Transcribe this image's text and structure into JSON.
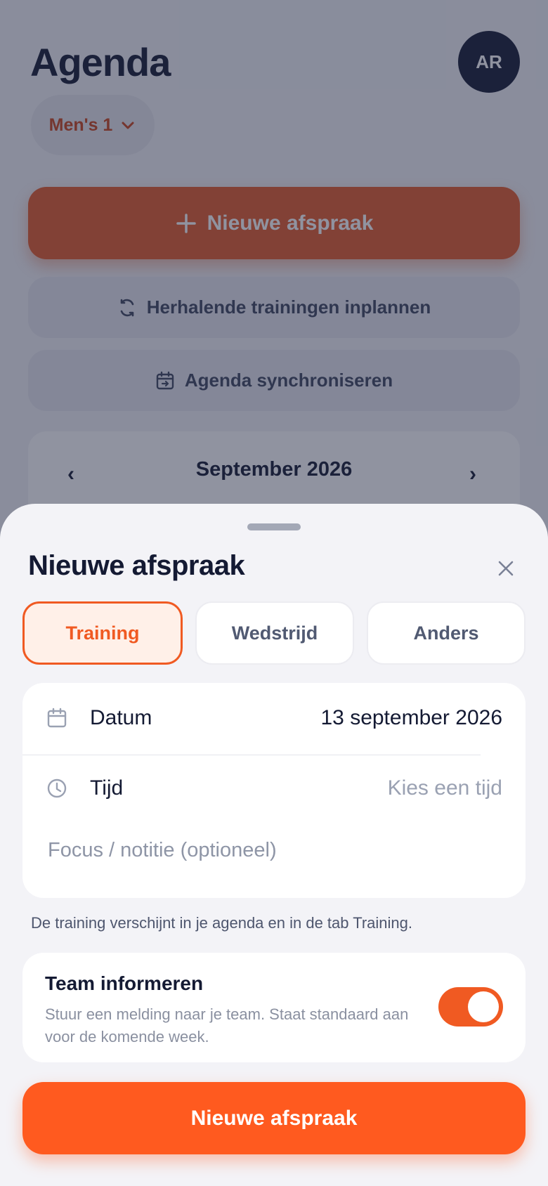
{
  "header": {
    "title": "Agenda",
    "avatar_initials": "AR",
    "team_select": "Men's 1"
  },
  "actions": {
    "new_label": "Nieuwe afspraak",
    "recurring_label": "Herhalende trainingen inplannen",
    "sync_label": "Agenda synchroniseren"
  },
  "calendar": {
    "month": "September 2026"
  },
  "sheet": {
    "title": "Nieuwe afspraak",
    "types": [
      {
        "label": "Training",
        "selected": true
      },
      {
        "label": "Wedstrijd",
        "selected": false
      },
      {
        "label": "Anders",
        "selected": false
      }
    ],
    "date_label": "Datum",
    "date_value": "13 september 2026",
    "time_label": "Tijd",
    "time_placeholder": "Kies een tijd",
    "note_placeholder": "Focus / notitie (optioneel)",
    "hint": "De training verschijnt in je agenda en in de tab Training.",
    "notify_title": "Team informeren",
    "notify_desc": "Stuur een melding naar je team. Staat standaard aan voor de komende week.",
    "notify_on": true,
    "submit_label": "Nieuwe afspraak"
  },
  "colors": {
    "accent": "#ff5a1f",
    "dark": "#141a33"
  }
}
